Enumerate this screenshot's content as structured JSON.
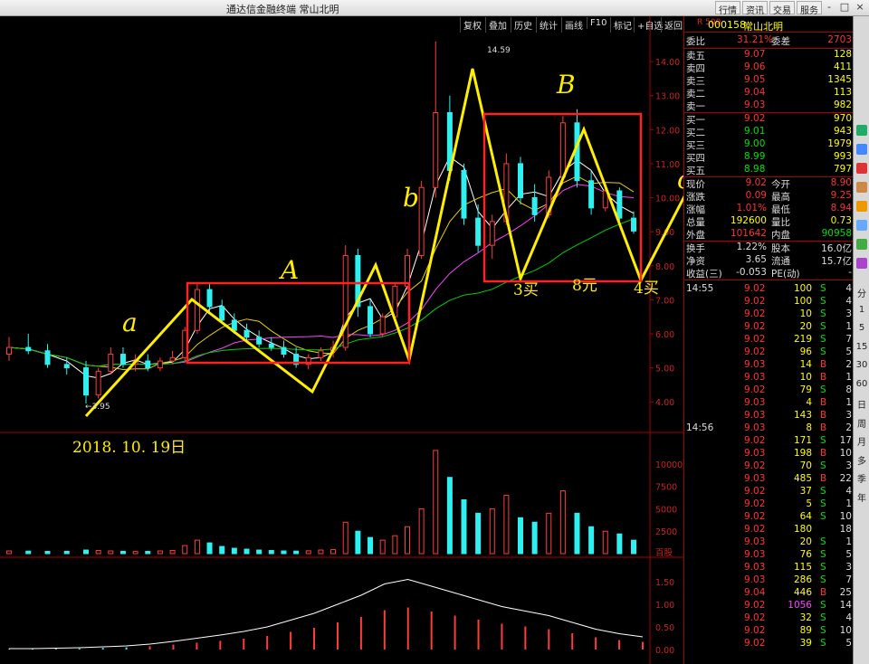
{
  "window": {
    "title": "通达信金融终端  常山北明",
    "menus": [
      "行情",
      "资讯",
      "交易",
      "服务"
    ],
    "controls": [
      "-",
      "□",
      "×"
    ]
  },
  "toolbar": [
    "复权",
    "叠加",
    "历史",
    "统计",
    "画线",
    "F10",
    "标记",
    "+自选",
    "返回"
  ],
  "stock": {
    "market_badge": "R 500",
    "code": "000158",
    "name": "常山北明"
  },
  "order_book": {
    "ratio": {
      "label": "委比",
      "value": "31.21%",
      "diff_label": "委差",
      "diff": "2703"
    },
    "asks": [
      {
        "label": "卖五",
        "price": "9.07",
        "vol": "128"
      },
      {
        "label": "卖四",
        "price": "9.06",
        "vol": "411"
      },
      {
        "label": "卖三",
        "price": "9.05",
        "vol": "1345"
      },
      {
        "label": "卖二",
        "price": "9.04",
        "vol": "113"
      },
      {
        "label": "卖一",
        "price": "9.03",
        "vol": "982"
      }
    ],
    "bids": [
      {
        "label": "买一",
        "price": "9.02",
        "vol": "970"
      },
      {
        "label": "买二",
        "price": "9.01",
        "vol": "943"
      },
      {
        "label": "买三",
        "price": "9.00",
        "vol": "1979"
      },
      {
        "label": "买四",
        "price": "8.99",
        "vol": "993"
      },
      {
        "label": "买五",
        "price": "8.98",
        "vol": "797"
      }
    ]
  },
  "quote_stats": [
    {
      "l1": "现价",
      "v1": "9.02",
      "c1": "red",
      "l2": "今开",
      "v2": "8.90",
      "c2": "red"
    },
    {
      "l1": "涨跌",
      "v1": "0.09",
      "c1": "red",
      "l2": "最高",
      "v2": "9.25",
      "c2": "red"
    },
    {
      "l1": "涨幅",
      "v1": "1.01%",
      "c1": "red",
      "l2": "最低",
      "v2": "8.94",
      "c2": "red"
    },
    {
      "l1": "总量",
      "v1": "192600",
      "c1": "yel",
      "l2": "量比",
      "v2": "0.73",
      "c2": "yel"
    },
    {
      "l1": "外盘",
      "v1": "101642",
      "c1": "red",
      "l2": "内盘",
      "v2": "90958",
      "c2": "grn"
    }
  ],
  "fundamentals": [
    {
      "l1": "换手",
      "v1": "1.22%",
      "l2": "股本",
      "v2": "16.0亿"
    },
    {
      "l1": "净资",
      "v1": "3.65",
      "l2": "流通",
      "v2": "15.7亿"
    },
    {
      "l1": "收益(三)",
      "v1": "-0.053",
      "l2": "PE(动)",
      "v2": "-"
    }
  ],
  "ticks": [
    {
      "time": "14:55",
      "price": "9.02",
      "vol": "100",
      "side": "S",
      "n": "4"
    },
    {
      "time": "",
      "price": "9.02",
      "vol": "100",
      "side": "S",
      "n": "4"
    },
    {
      "time": "",
      "price": "9.02",
      "vol": "10",
      "side": "S",
      "n": "3"
    },
    {
      "time": "",
      "price": "9.02",
      "vol": "20",
      "side": "S",
      "n": "1"
    },
    {
      "time": "",
      "price": "9.02",
      "vol": "219",
      "side": "S",
      "n": "7"
    },
    {
      "time": "",
      "price": "9.02",
      "vol": "96",
      "side": "S",
      "n": "5"
    },
    {
      "time": "",
      "price": "9.03",
      "vol": "14",
      "side": "B",
      "n": "2"
    },
    {
      "time": "",
      "price": "9.03",
      "vol": "10",
      "side": "B",
      "n": "1"
    },
    {
      "time": "",
      "price": "9.02",
      "vol": "79",
      "side": "S",
      "n": "8"
    },
    {
      "time": "",
      "price": "9.03",
      "vol": "4",
      "side": "B",
      "n": "1"
    },
    {
      "time": "",
      "price": "9.03",
      "vol": "143",
      "side": "B",
      "n": "3"
    },
    {
      "time": "14:56",
      "price": "9.03",
      "vol": "8",
      "side": "B",
      "n": "2"
    },
    {
      "time": "",
      "price": "9.02",
      "vol": "171",
      "side": "S",
      "n": "17"
    },
    {
      "time": "",
      "price": "9.03",
      "vol": "198",
      "side": "B",
      "n": "10"
    },
    {
      "time": "",
      "price": "9.02",
      "vol": "70",
      "side": "S",
      "n": "3"
    },
    {
      "time": "",
      "price": "9.03",
      "vol": "485",
      "side": "B",
      "n": "22"
    },
    {
      "time": "",
      "price": "9.02",
      "vol": "37",
      "side": "S",
      "n": "4"
    },
    {
      "time": "",
      "price": "9.02",
      "vol": "5",
      "side": "S",
      "n": "1"
    },
    {
      "time": "",
      "price": "9.02",
      "vol": "64",
      "side": "S",
      "n": "10"
    },
    {
      "time": "",
      "price": "9.02",
      "vol": "180",
      "side": "",
      "n": "18"
    },
    {
      "time": "",
      "price": "9.03",
      "vol": "20",
      "side": "S",
      "n": "1"
    },
    {
      "time": "",
      "price": "9.03",
      "vol": "76",
      "side": "S",
      "n": "5"
    },
    {
      "time": "",
      "price": "9.03",
      "vol": "115",
      "side": "S",
      "n": "3"
    },
    {
      "time": "",
      "price": "9.03",
      "vol": "286",
      "side": "S",
      "n": "7"
    },
    {
      "time": "",
      "price": "9.04",
      "vol": "446",
      "side": "B",
      "n": "25"
    },
    {
      "time": "",
      "price": "9.02",
      "vol": "1056",
      "side": "S",
      "n": "14"
    },
    {
      "time": "",
      "price": "9.02",
      "vol": "32",
      "side": "S",
      "n": "4"
    },
    {
      "time": "",
      "price": "9.02",
      "vol": "89",
      "side": "S",
      "n": "10"
    },
    {
      "time": "",
      "price": "9.02",
      "vol": "39",
      "side": "S",
      "n": "5"
    }
  ],
  "right_toolbar": [
    "分",
    "1",
    "5",
    "15",
    "30",
    "60",
    "日",
    "周",
    "月",
    "多",
    "季",
    "年"
  ],
  "chart_labels": {
    "high_label": "14.59",
    "low_label": "←3.95",
    "date_note": "2018. 10. 19日",
    "wave_labels": [
      "a",
      "A",
      "b",
      "B",
      "c"
    ],
    "buy_labels": [
      "3买",
      "8元",
      "4买"
    ],
    "price_axis": [
      "14.00",
      "13.00",
      "12.00",
      "11.00",
      "10.00",
      "9.00",
      "8.00",
      "7.00",
      "6.00",
      "5.00",
      "4.00"
    ],
    "volume_axis": [
      "10000",
      "7500",
      "5000",
      "2500",
      "百股"
    ],
    "macd_axis": [
      "1.50",
      "1.00",
      "0.50",
      "0.00"
    ]
  },
  "chart_data": {
    "type": "candlestick",
    "price_range": [
      3.5,
      14.8
    ],
    "candles_sample_ohlc": [
      [
        5.4,
        5.9,
        5.2,
        5.6
      ],
      [
        5.6,
        6.0,
        5.4,
        5.5
      ],
      [
        5.5,
        5.7,
        5.0,
        5.1
      ],
      [
        5.1,
        5.3,
        4.8,
        5.0
      ],
      [
        5.0,
        5.2,
        3.95,
        4.2
      ],
      [
        4.2,
        5.0,
        4.1,
        4.9
      ],
      [
        4.9,
        5.6,
        4.8,
        5.4
      ],
      [
        5.4,
        5.6,
        5.0,
        5.1
      ],
      [
        5.1,
        5.4,
        4.9,
        5.2
      ],
      [
        5.2,
        5.4,
        4.9,
        5.0
      ],
      [
        5.0,
        5.3,
        4.9,
        5.2
      ],
      [
        5.2,
        5.5,
        5.1,
        5.3
      ],
      [
        5.3,
        6.2,
        5.2,
        6.1
      ],
      [
        6.1,
        7.5,
        6.0,
        7.3
      ],
      [
        7.3,
        7.5,
        6.6,
        6.8
      ],
      [
        6.8,
        7.0,
        6.3,
        6.4
      ],
      [
        6.4,
        6.6,
        6.0,
        6.1
      ],
      [
        6.1,
        6.3,
        5.8,
        5.9
      ],
      [
        5.9,
        6.1,
        5.6,
        5.7
      ],
      [
        5.7,
        5.9,
        5.5,
        5.6
      ],
      [
        5.6,
        5.8,
        5.3,
        5.4
      ],
      [
        5.4,
        5.6,
        5.0,
        5.1
      ],
      [
        5.1,
        5.4,
        4.95,
        5.3
      ],
      [
        5.3,
        5.6,
        5.2,
        5.5
      ],
      [
        5.5,
        5.8,
        5.3,
        5.6
      ],
      [
        5.6,
        8.6,
        5.5,
        8.3
      ],
      [
        8.3,
        8.5,
        6.5,
        6.8
      ],
      [
        6.8,
        7.0,
        5.9,
        6.0
      ],
      [
        6.0,
        6.6,
        5.9,
        6.5
      ],
      [
        6.5,
        7.5,
        6.4,
        7.4
      ],
      [
        7.4,
        8.5,
        7.3,
        8.3
      ],
      [
        8.3,
        10.5,
        8.2,
        10.3
      ],
      [
        10.3,
        14.59,
        10.0,
        12.5
      ],
      [
        12.5,
        13.0,
        10.5,
        10.8
      ],
      [
        10.8,
        11.0,
        9.2,
        9.4
      ],
      [
        9.4,
        9.8,
        8.4,
        8.6
      ],
      [
        8.6,
        9.5,
        8.2,
        9.3
      ],
      [
        9.3,
        11.3,
        9.2,
        11.0
      ],
      [
        11.0,
        11.2,
        9.8,
        10.0
      ],
      [
        10.0,
        10.4,
        9.3,
        9.5
      ],
      [
        9.5,
        10.8,
        9.4,
        10.6
      ],
      [
        10.6,
        12.4,
        10.5,
        12.2
      ],
      [
        12.2,
        12.6,
        10.3,
        10.5
      ],
      [
        10.5,
        10.8,
        9.5,
        9.7
      ],
      [
        9.7,
        10.4,
        9.6,
        10.2
      ],
      [
        10.2,
        10.3,
        9.3,
        9.4
      ],
      [
        9.4,
        9.6,
        8.94,
        9.02
      ]
    ],
    "volume_sample": [
      300,
      280,
      250,
      260,
      400,
      350,
      300,
      260,
      240,
      250,
      300,
      350,
      900,
      1500,
      1200,
      800,
      600,
      500,
      400,
      350,
      300,
      280,
      320,
      400,
      450,
      3500,
      2500,
      1800,
      1500,
      2000,
      3000,
      5000,
      11500,
      8500,
      6000,
      4500,
      5000,
      6500,
      4000,
      3500,
      4500,
      7000,
      4500,
      3000,
      2500,
      2200,
      1500
    ],
    "macd_sample": [
      0.02,
      0.02,
      0.03,
      0.04,
      0.06,
      0.08,
      0.12,
      0.18,
      0.25,
      0.32,
      0.4,
      0.5,
      0.65,
      0.8,
      1.0,
      1.2,
      1.45,
      1.55,
      1.4,
      1.25,
      1.1,
      0.95,
      0.85,
      0.75,
      0.6,
      0.45,
      0.35,
      0.28
    ]
  }
}
